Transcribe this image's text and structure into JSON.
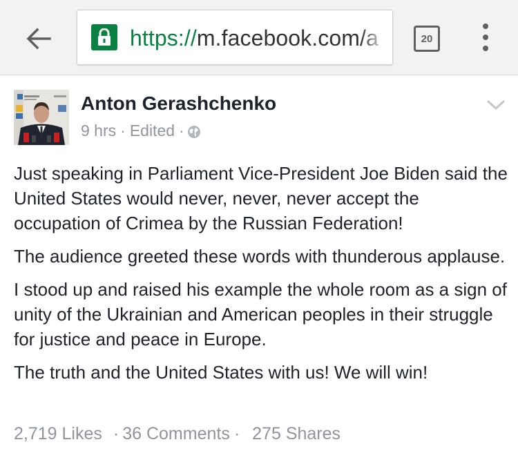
{
  "browser": {
    "url_scheme": "https://",
    "url_host": "m.facebook.com/a",
    "tab_count": "20"
  },
  "post": {
    "author": "Anton Gerashchenko",
    "time": "9 hrs",
    "edited": "Edited",
    "paragraphs": [
      "Just speaking in Parliament Vice-President Joe Biden said the United States would never, never, never accept the occupation of Crimea by the Russian Federation!",
      "The audience greeted these words with thunderous applause.",
      "I stood up and raised his example the whole room as a sign of unity of the Ukrainian and American peoples in their struggle for justice and peace in Europe.",
      "The truth and the United States with us! We will win!"
    ],
    "likes": "2,719 Likes",
    "comments": "36 Comments",
    "shares": "275 Shares"
  },
  "icons": {
    "back": "back-arrow-icon",
    "lock": "lock-icon",
    "menu": "more-vertical-icon",
    "audience": "globe-icon",
    "options": "chevron-down-icon"
  },
  "colors": {
    "toolbar_bg": "#f2f2f2",
    "secure_green": "#0b8043",
    "text_primary": "#1d2129",
    "text_secondary": "#90949c"
  }
}
